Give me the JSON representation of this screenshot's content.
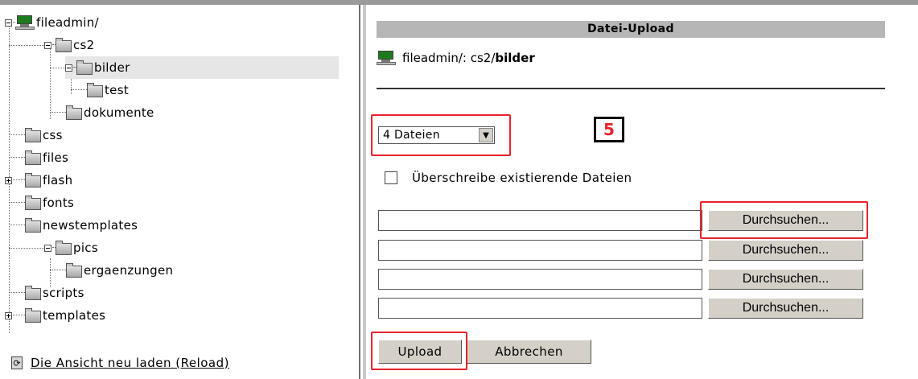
{
  "tree": {
    "root": "fileadmin/",
    "items": [
      {
        "label": "cs2"
      },
      {
        "label": "bilder"
      },
      {
        "label": "test"
      },
      {
        "label": "dokumente"
      },
      {
        "label": "css"
      },
      {
        "label": "files"
      },
      {
        "label": "flash"
      },
      {
        "label": "fonts"
      },
      {
        "label": "newstemplates"
      },
      {
        "label": "pics"
      },
      {
        "label": "ergaenzungen"
      },
      {
        "label": "scripts"
      },
      {
        "label": "templates"
      }
    ],
    "selected": "bilder",
    "reload_label": "Die Ansicht neu laden (Reload)"
  },
  "upload": {
    "title": "Datei-Upload",
    "path_prefix": "fileadmin/: cs2/",
    "path_current": "bilder",
    "count_select": "4 Dateien",
    "step_badge": "5",
    "overwrite_label": "Überschreibe existierende Dateien",
    "browse_label": "Durchsuchen...",
    "upload_label": "Upload",
    "cancel_label": "Abbrechen"
  },
  "colors": {
    "highlight": "#e8232a",
    "titlebar": "#b6b6b6",
    "button_face": "#d4d0c8",
    "selected_row": "#e6e6e6"
  }
}
